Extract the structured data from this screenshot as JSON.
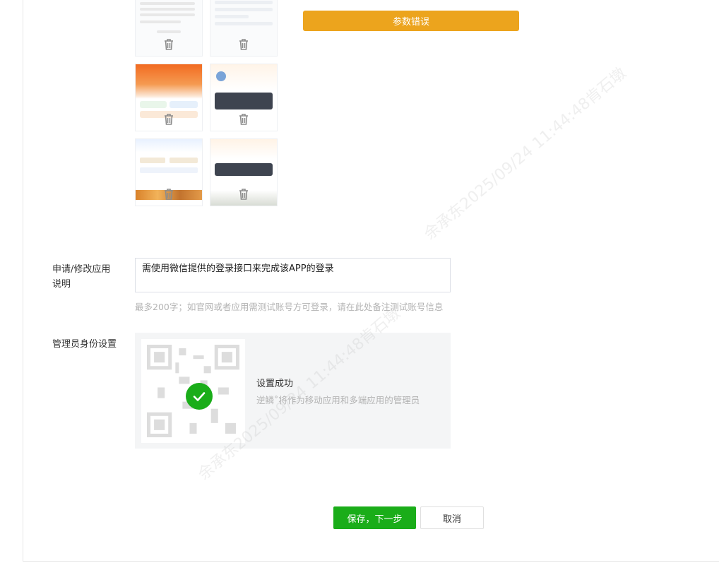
{
  "error": {
    "message": "参数错误"
  },
  "description": {
    "label": "申请/修改应用说明",
    "value": "需使用微信提供的登录接口来完成该APP的登录",
    "hint": "最多200字；如官网或者应用需测试账号方可登录，请在此处备注测试账号信息"
  },
  "admin": {
    "label": "管理员身份设置",
    "status_title": "设置成功",
    "status_detail": "逆鳞˚将作为移动应用和多端应用的管理员"
  },
  "actions": {
    "save_next": "保存，下一步",
    "cancel": "取消"
  },
  "watermark": {
    "text": "余承东2025/09/24 11:44:48肯石墩"
  },
  "icons": {
    "delete": "trash-icon",
    "success": "check-circle-icon"
  },
  "colors": {
    "primary": "#1aad19",
    "warning": "#eca41d",
    "hint": "#b4b4b4"
  }
}
